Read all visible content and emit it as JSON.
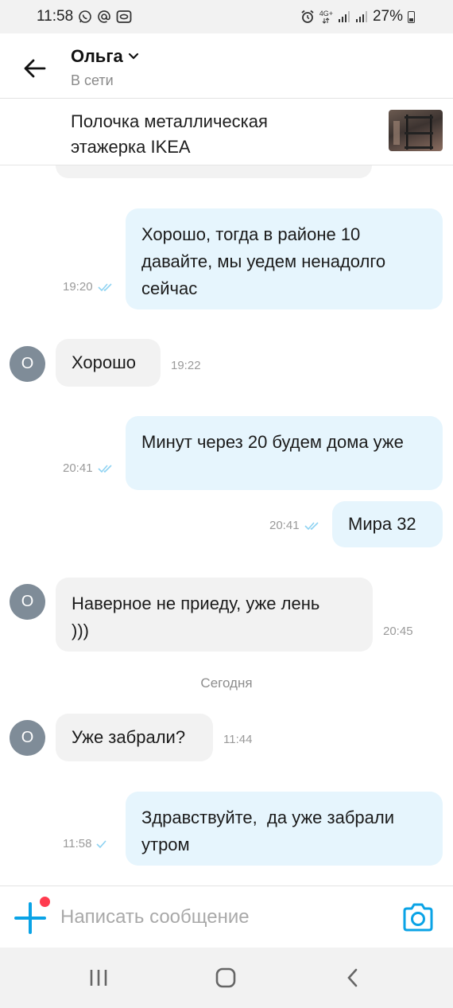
{
  "status_bar": {
    "time": "11:58",
    "left_icons": [
      "whatsapp-icon",
      "at-sign-icon",
      "message-box-icon"
    ],
    "right_icons": [
      "alarm-icon",
      "4g-signal-icon",
      "signal-bars-icon",
      "signal-bars-icon",
      "battery-icon"
    ],
    "network_label": "4G+",
    "battery": "27%"
  },
  "header": {
    "back_icon": "arrow-left-icon",
    "contact_name": "Ольга",
    "name_dropdown_icon": "chevron-down-icon",
    "contact_status": "В сети"
  },
  "ad": {
    "title": "Полочка металлическая этажерка IKEA",
    "thumbnail": "product-thumbnail"
  },
  "messages": [
    {
      "direction": "out",
      "text": "Хорошо, тогда в районе 10 давайте, мы уедем ненадолго сейчас",
      "time": "19:20",
      "status": "read"
    },
    {
      "direction": "in",
      "avatar": "О",
      "text": "Хорошо",
      "time": "19:22"
    },
    {
      "direction": "out",
      "text": "Минут через 20 будем дома уже",
      "time": "20:41",
      "status": "read"
    },
    {
      "direction": "out",
      "text": "Мира 32",
      "time": "20:41",
      "status": "read"
    },
    {
      "direction": "in",
      "avatar": "О",
      "text": "Наверное не приеду, уже лень )))",
      "time": "20:45"
    },
    {
      "direction": "in",
      "avatar": "О",
      "text": "Уже забрали?",
      "time": "11:44"
    },
    {
      "direction": "out",
      "text": "Здравствуйте,  да уже забрали утром",
      "time": "11:58",
      "status": "delivered"
    }
  ],
  "date_divider": "Сегодня",
  "composer": {
    "placeholder": "Написать сообщение",
    "value": "",
    "add_icon": "plus-icon",
    "camera_icon": "camera-icon"
  },
  "nav_bar": {
    "buttons": [
      "recent-apps-icon",
      "home-icon",
      "back-icon"
    ]
  },
  "colors": {
    "accent": "#0aa3e6",
    "outgoing_bubble": "#e6f5fd",
    "incoming_bubble": "#f2f2f2",
    "avatar": "#7f8c98",
    "notification_dot": "#ff3b4f"
  }
}
